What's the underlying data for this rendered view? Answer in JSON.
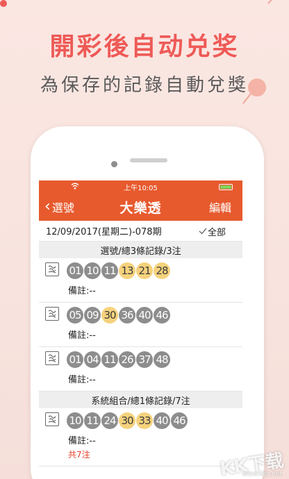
{
  "promo": {
    "headline": "開彩後自动兑奖",
    "subline": "為保存的記錄自動兌獎"
  },
  "status_bar": {
    "time": "上午10:05"
  },
  "navbar": {
    "back_label": "選號",
    "back_icon": "chevron-left-icon",
    "title": "大樂透",
    "edit_label": "編輯"
  },
  "draw": {
    "label": "12/09/2017(星期二)-078期",
    "filter_label": "全部",
    "filter_icon": "check-icon"
  },
  "sections": [
    {
      "title": "選號/總3條記錄/3注",
      "entries": [
        {
          "balls": [
            {
              "n": "01",
              "hit": false
            },
            {
              "n": "10",
              "hit": false
            },
            {
              "n": "11",
              "hit": false
            },
            {
              "n": "13",
              "hit": true
            },
            {
              "n": "21",
              "hit": true
            },
            {
              "n": "28",
              "hit": true
            }
          ],
          "note": "備註:--"
        },
        {
          "balls": [
            {
              "n": "05",
              "hit": false
            },
            {
              "n": "09",
              "hit": false
            },
            {
              "n": "30",
              "hit": true
            },
            {
              "n": "36",
              "hit": false
            },
            {
              "n": "40",
              "hit": false
            },
            {
              "n": "46",
              "hit": false
            }
          ],
          "note": "備註:--"
        },
        {
          "balls": [
            {
              "n": "01",
              "hit": false
            },
            {
              "n": "04",
              "hit": false
            },
            {
              "n": "11",
              "hit": false
            },
            {
              "n": "26",
              "hit": false
            },
            {
              "n": "37",
              "hit": false
            },
            {
              "n": "48",
              "hit": false
            }
          ],
          "note": "備註:--"
        }
      ]
    },
    {
      "title": "系統組合/總1條記錄/7注",
      "entries": [
        {
          "balls": [
            {
              "n": "10",
              "hit": false
            },
            {
              "n": "11",
              "hit": false
            },
            {
              "n": "24",
              "hit": false
            },
            {
              "n": "30",
              "hit": true
            },
            {
              "n": "33",
              "hit": true
            },
            {
              "n": "40",
              "hit": false
            },
            {
              "n": "46",
              "hit": false
            }
          ],
          "note": "備註:--",
          "count": "共7注"
        }
      ]
    }
  ],
  "colors": {
    "brand": "#e75a2e",
    "headline": "#ee5a57",
    "ball_default": "#8d8d8d",
    "ball_hit": "#f5d27c",
    "count_text": "#e8402a"
  },
  "watermark": {
    "text": "KK下载",
    "url": "www.kkx.net"
  }
}
